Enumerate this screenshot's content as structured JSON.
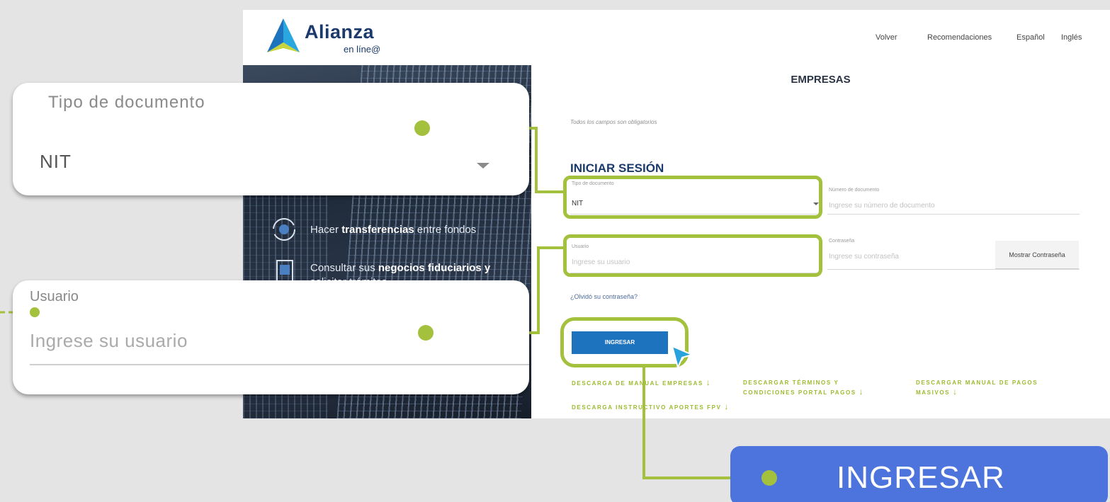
{
  "header": {
    "logo_name": "Alianza",
    "logo_sub": "en líne@",
    "nav": [
      "Volver",
      "Recomendaciones",
      "Español",
      "Inglés"
    ]
  },
  "hero": {
    "item1_prefix": "Hacer ",
    "item1_bold": "transferencias",
    "item1_suffix": " entre fondos",
    "item2_prefix": "Consultar sus ",
    "item2_bold": "negocios fiduciarios y",
    "item2_line2": "solicitar trámites"
  },
  "form": {
    "section_title": "EMPRESAS",
    "required_note": "Todos los campos son obligatorios",
    "heading": "INICIAR SESIÓN",
    "doc_type_label": "Tipo de documento",
    "doc_type_value": "NIT",
    "doc_number_label": "Número de documento",
    "doc_number_placeholder": "Ingrese su número de documento",
    "user_label": "Usuario",
    "user_placeholder": "Ingrese su usuario",
    "password_label": "Contraseña",
    "password_placeholder": "Ingrese su contraseña",
    "show_password": "Mostrar Contraseña",
    "forgot": "¿Olvidó su contraseña?",
    "submit": "INGRESAR"
  },
  "downloads": {
    "d1": "DESCARGA DE MANUAL EMPRESAS",
    "d2_line1": "DESCARGAR TÉRMINOS Y",
    "d2_line2": "CONDICIONES PORTAL PAGOS",
    "d3_line1": "DESCARGAR MANUAL DE PAGOS",
    "d3_line2": "MASIVOS",
    "d4": "DESCARGA INSTRUCTIVO APORTES FPV"
  },
  "callouts": {
    "doc_label": "Tipo de documento",
    "doc_value": "NIT",
    "user_label": "Usuario",
    "user_placeholder": "Ingrese su usuario",
    "button_label": "INGRESAR"
  },
  "colors": {
    "accent_green": "#a3c13d",
    "brand_blue": "#1b3a6b",
    "button_blue": "#1e73be",
    "callout_blue": "#4d74dd"
  }
}
